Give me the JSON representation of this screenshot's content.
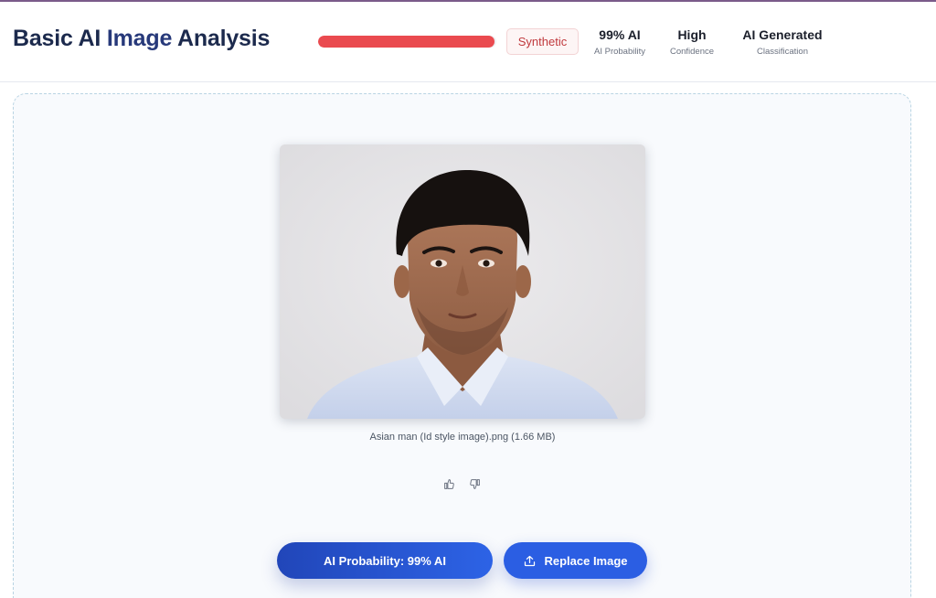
{
  "app": {
    "title_part1": "Basic AI ",
    "title_part2": "Image",
    "title_part3": " Analysis"
  },
  "summary": {
    "probability_fill": 0.99,
    "bar_color": "#ea4a4f",
    "badge": "Synthetic",
    "stats": [
      {
        "value": "99% AI",
        "label": "AI Probability"
      },
      {
        "value": "High",
        "label": "Confidence"
      },
      {
        "value": "AI Generated",
        "label": "Classification"
      }
    ]
  },
  "image": {
    "caption": "Asian man (Id style image).png (1.66 MB)"
  },
  "feedback": {
    "like_icon": "thumbs-up-icon",
    "dislike_icon": "thumbs-down-icon"
  },
  "actions": {
    "probability_label": "AI Probability: 99% AI",
    "replace_label": "Replace Image",
    "replace_icon": "upload-icon"
  },
  "colors": {
    "primary": "#2b5ee3",
    "title": "#1c2a4d",
    "danger": "#ea4a4f"
  }
}
